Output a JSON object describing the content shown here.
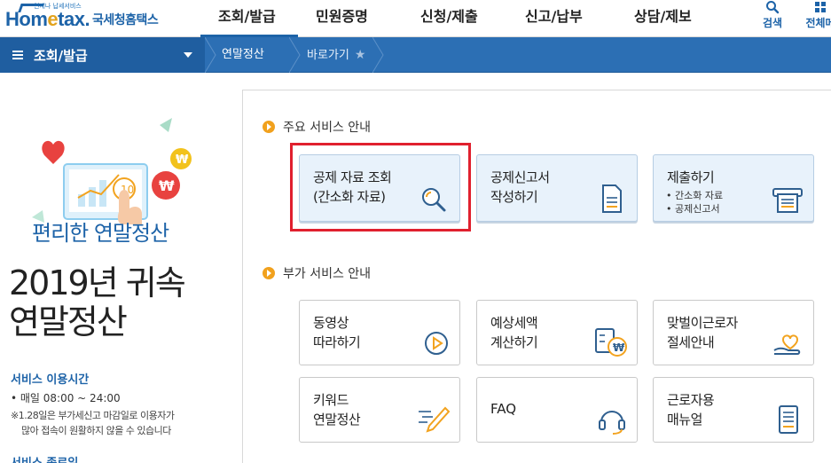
{
  "header": {
    "logo_small": "언제나 납세서비스",
    "logo_text_1": "Hom",
    "logo_text_2": "e",
    "logo_text_3": "tax.",
    "logo_name": "국세청홈택스",
    "nav": [
      "조회/발급",
      "민원증명",
      "신청/제출",
      "신고/납부",
      "상담/제보"
    ],
    "search_label": "검색",
    "all_label": "전체메"
  },
  "location": {
    "menu_label": "조회/발급",
    "crumb1": "연말정산",
    "crumb2": "바로가기",
    "star_glyph": "★"
  },
  "promo": {
    "subtitle": "편리한 연말정산",
    "title_line1": "2019년 귀속",
    "title_line2": "연말정산",
    "service_time_title": "서비스 이용시간",
    "service_time": "• 매일 08:00 ~ 24:00",
    "service_note_1": "※1.28일은 부가세신고 마감일로 이용자가",
    "service_note_2": "많아 접속이 원활하지 않을 수 있습니다",
    "service_end_title": "서비스 종료일"
  },
  "main": {
    "section1_title": "주요 서비스 안내",
    "section2_title": "부가 서비스 안내",
    "cards_main": [
      {
        "line1": "공제 자료 조회",
        "line2": "(간소화 자료)",
        "icon": "magnifier-icon"
      },
      {
        "line1": "공제신고서",
        "line2": "작성하기",
        "icon": "document-icon"
      },
      {
        "line1": "제출하기",
        "bullet1": "• 간소화 자료",
        "bullet2": "• 공제신고서",
        "icon": "printer-icon"
      }
    ],
    "cards_extra": [
      {
        "line1": "동영상",
        "line2": "따라하기",
        "icon": "play-icon"
      },
      {
        "line1": "예상세액",
        "line2": "계산하기",
        "icon": "calculator-icon"
      },
      {
        "line1": "맞벌이근로자",
        "line2": "절세안내",
        "icon": "heart-hand-icon"
      },
      {
        "line1": "키워드",
        "line2": "연말정산",
        "icon": "pencil-icon"
      },
      {
        "single": "FAQ",
        "icon": "headset-icon"
      },
      {
        "line1": "근로자용",
        "line2": "매뉴얼",
        "icon": "manual-icon"
      }
    ]
  },
  "colors": {
    "brand_blue": "#1d63a8",
    "bar_blue": "#2c6fb4",
    "accent_orange": "#f1a11d",
    "highlight_red": "#e0202e",
    "card_main_bg": "#e8f2fb"
  }
}
